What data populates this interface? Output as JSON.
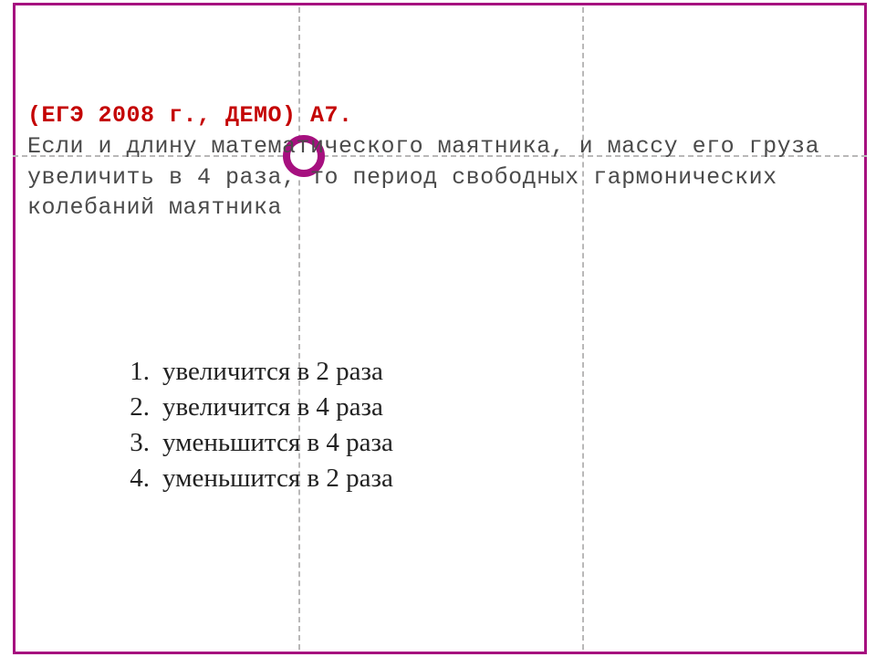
{
  "heading": {
    "title": "(ЕГЭ 2008 г., ДЕМО) А7.",
    "body": "Если и длину математического маятника, и массу его груза увеличить в 4 раза, то период свободных гармонических колебаний маятника"
  },
  "answers": [
    {
      "num": "1.",
      "text": "увеличится в 2 раза"
    },
    {
      "num": "2.",
      "text": "увеличится в 4 раза"
    },
    {
      "num": "3.",
      "text": "уменьшится в 4 раза"
    },
    {
      "num": "4.",
      "text": "уменьшится в 2 раза"
    }
  ]
}
